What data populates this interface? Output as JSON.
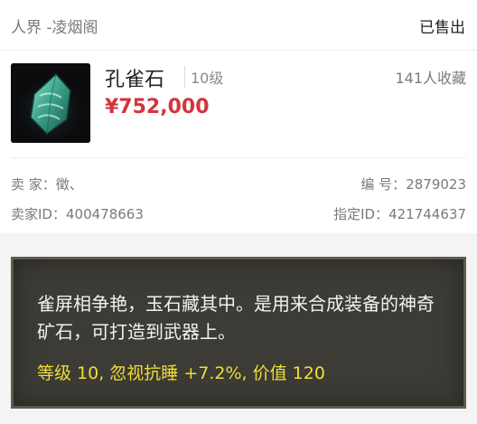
{
  "header": {
    "server": "人界 -凌烟阁",
    "status": "已售出"
  },
  "item": {
    "name": "孔雀石",
    "level": "10级",
    "price": "¥752,000",
    "favorites": "141人收藏",
    "icon": "peacock-stone-icon"
  },
  "info": {
    "seller_label": "卖 家：",
    "seller": "徵、",
    "seller_id_label": "卖家ID：",
    "seller_id": "400478663",
    "serial_label": "编 号：",
    "serial": "2879023",
    "designated_id_label": "指定ID：",
    "designated_id": "421744637"
  },
  "description": {
    "text": "雀屏相争艳，玉石藏其中。是用来合成装备的神奇矿石，可打造到武器上。",
    "stats": "等级 10, 忽视抗睡 +7.2%, 价值 120"
  },
  "colors": {
    "price": "#d3343c",
    "stats": "#f0de35",
    "panel": "#3c3b35"
  }
}
